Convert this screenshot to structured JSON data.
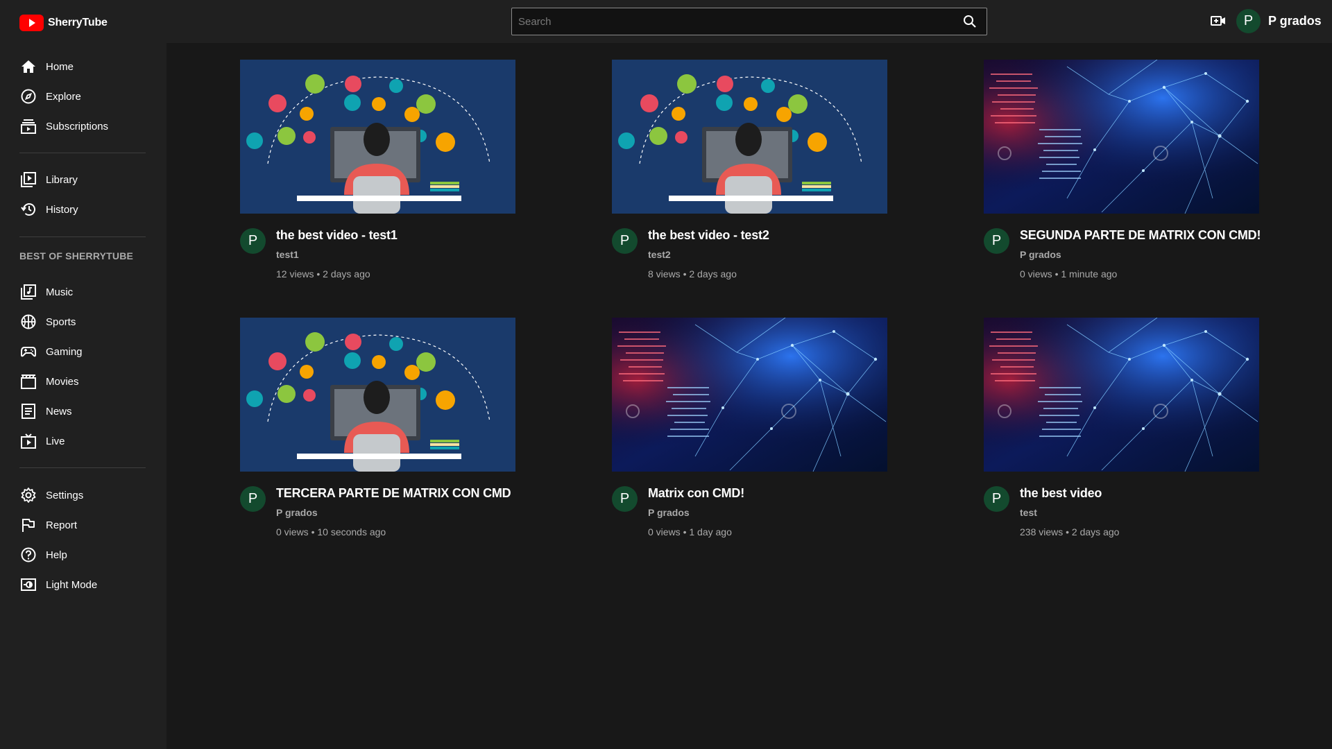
{
  "app": {
    "name": "SherryTube"
  },
  "search": {
    "placeholder": "Search"
  },
  "user": {
    "initial": "P",
    "name": "P grados"
  },
  "sidebar": {
    "main": [
      {
        "label": "Home",
        "icon": "home-icon"
      },
      {
        "label": "Explore",
        "icon": "compass-icon"
      },
      {
        "label": "Subscriptions",
        "icon": "subscriptions-icon"
      }
    ],
    "library": [
      {
        "label": "Library",
        "icon": "library-icon"
      },
      {
        "label": "History",
        "icon": "history-icon"
      }
    ],
    "best_title": "BEST OF SHERRYTUBE",
    "best": [
      {
        "label": "Music",
        "icon": "music-icon"
      },
      {
        "label": "Sports",
        "icon": "sports-icon"
      },
      {
        "label": "Gaming",
        "icon": "gaming-icon"
      },
      {
        "label": "Movies",
        "icon": "movies-icon"
      },
      {
        "label": "News",
        "icon": "news-icon"
      },
      {
        "label": "Live",
        "icon": "live-icon"
      }
    ],
    "footer": [
      {
        "label": "Settings",
        "icon": "settings-icon"
      },
      {
        "label": "Report",
        "icon": "flag-icon"
      },
      {
        "label": "Help",
        "icon": "help-icon"
      },
      {
        "label": "Light Mode",
        "icon": "light-mode-icon"
      }
    ]
  },
  "videos": [
    {
      "title": "the best video - test1",
      "channel": "test1",
      "stats": "12 views • 2 days ago",
      "avatar": "P",
      "thumbnail": "programming-illustration"
    },
    {
      "title": "the best video - test2",
      "channel": "test2",
      "stats": "8 views • 2 days ago",
      "avatar": "P",
      "thumbnail": "programming-illustration"
    },
    {
      "title": "SEGUNDA PARTE DE MATRIX CON CMD!",
      "channel": "P grados",
      "stats": "0 views • 1 minute ago",
      "avatar": "P",
      "thumbnail": "matrix-network"
    },
    {
      "title": "TERCERA PARTE DE MATRIX CON CMD",
      "channel": "P grados",
      "stats": "0 views • 10 seconds ago",
      "avatar": "P",
      "thumbnail": "programming-illustration"
    },
    {
      "title": "Matrix con CMD!",
      "channel": "P grados",
      "stats": "0 views • 1 day ago",
      "avatar": "P",
      "thumbnail": "matrix-network"
    },
    {
      "title": "the best video",
      "channel": "test",
      "stats": "238 views • 2 days ago",
      "avatar": "P",
      "thumbnail": "matrix-network"
    }
  ],
  "colors": {
    "background": "#181818",
    "surface": "#202020",
    "brand": "#ff0000",
    "avatar": "#134a2e",
    "secondary_text": "#aaaaaa"
  }
}
